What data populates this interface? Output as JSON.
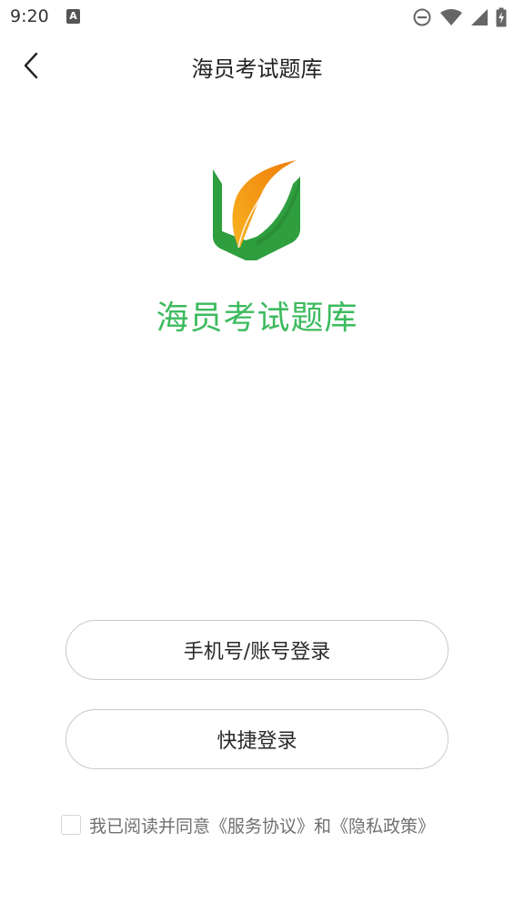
{
  "status_bar": {
    "time": "9:20",
    "notification_icon": "font-a-icon",
    "icons": [
      "do-not-disturb-icon",
      "wifi-icon",
      "signal-icon",
      "battery-charging-icon"
    ]
  },
  "nav": {
    "title": "海员考试题库",
    "back_icon": "chevron-left-icon"
  },
  "app": {
    "name": "海员考试题库",
    "brand_color": "#3dbb5e",
    "logo_colors": {
      "book": "#2e9e3e",
      "leaf": "#f39a12"
    }
  },
  "buttons": {
    "phone_login": "手机号/账号登录",
    "quick_login": "快捷登录"
  },
  "agreement": {
    "prefix": "我已阅读并同意",
    "service_link": "《服务协议》",
    "conjunction": "和",
    "privacy_link": "《隐私政策》",
    "checked": false
  }
}
